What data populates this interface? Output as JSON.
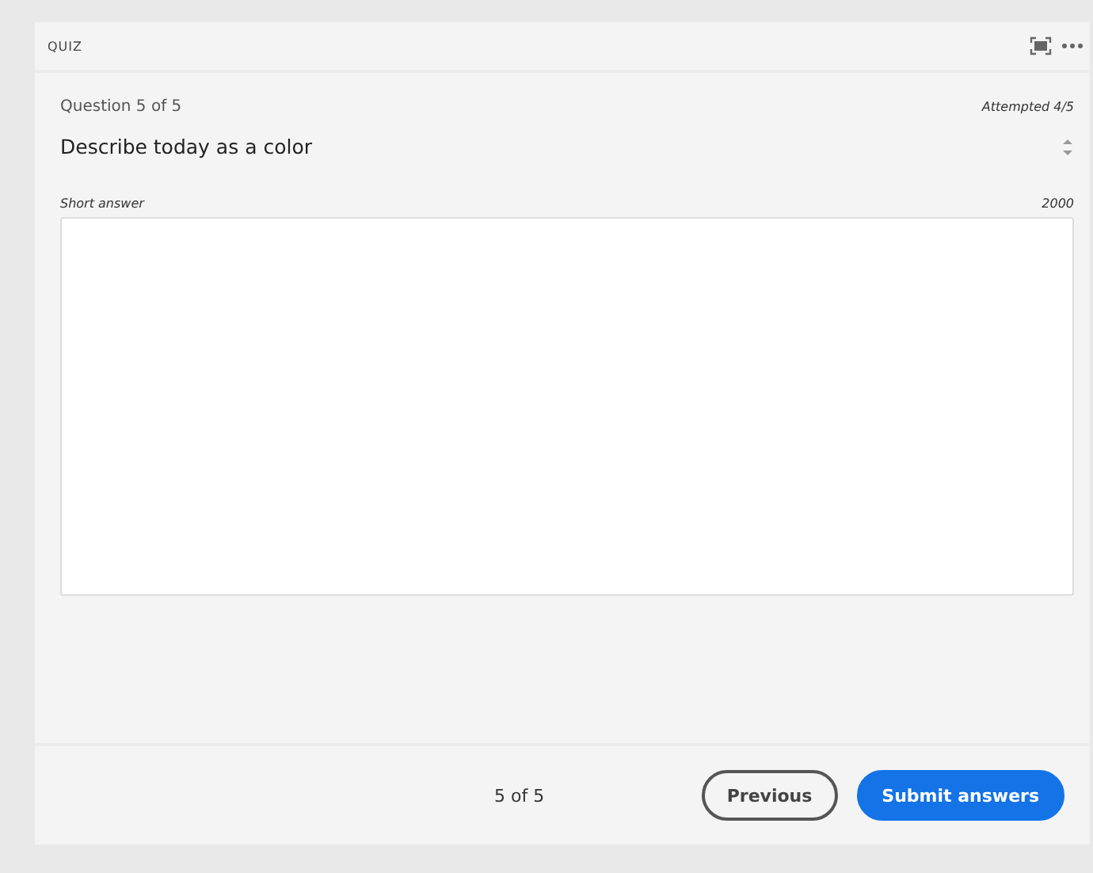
{
  "panel": {
    "title": "QUIZ"
  },
  "question": {
    "progress": "Question 5 of 5",
    "attempted": "Attempted 4/5",
    "text": "Describe today as a color"
  },
  "answer": {
    "label": "Short answer",
    "limit": "2000"
  },
  "footer": {
    "pager": "5 of 5",
    "buttons": [
      {
        "label": "Previous",
        "kind": "secondary"
      },
      {
        "label": "Submit answers",
        "kind": "primary"
      }
    ]
  }
}
